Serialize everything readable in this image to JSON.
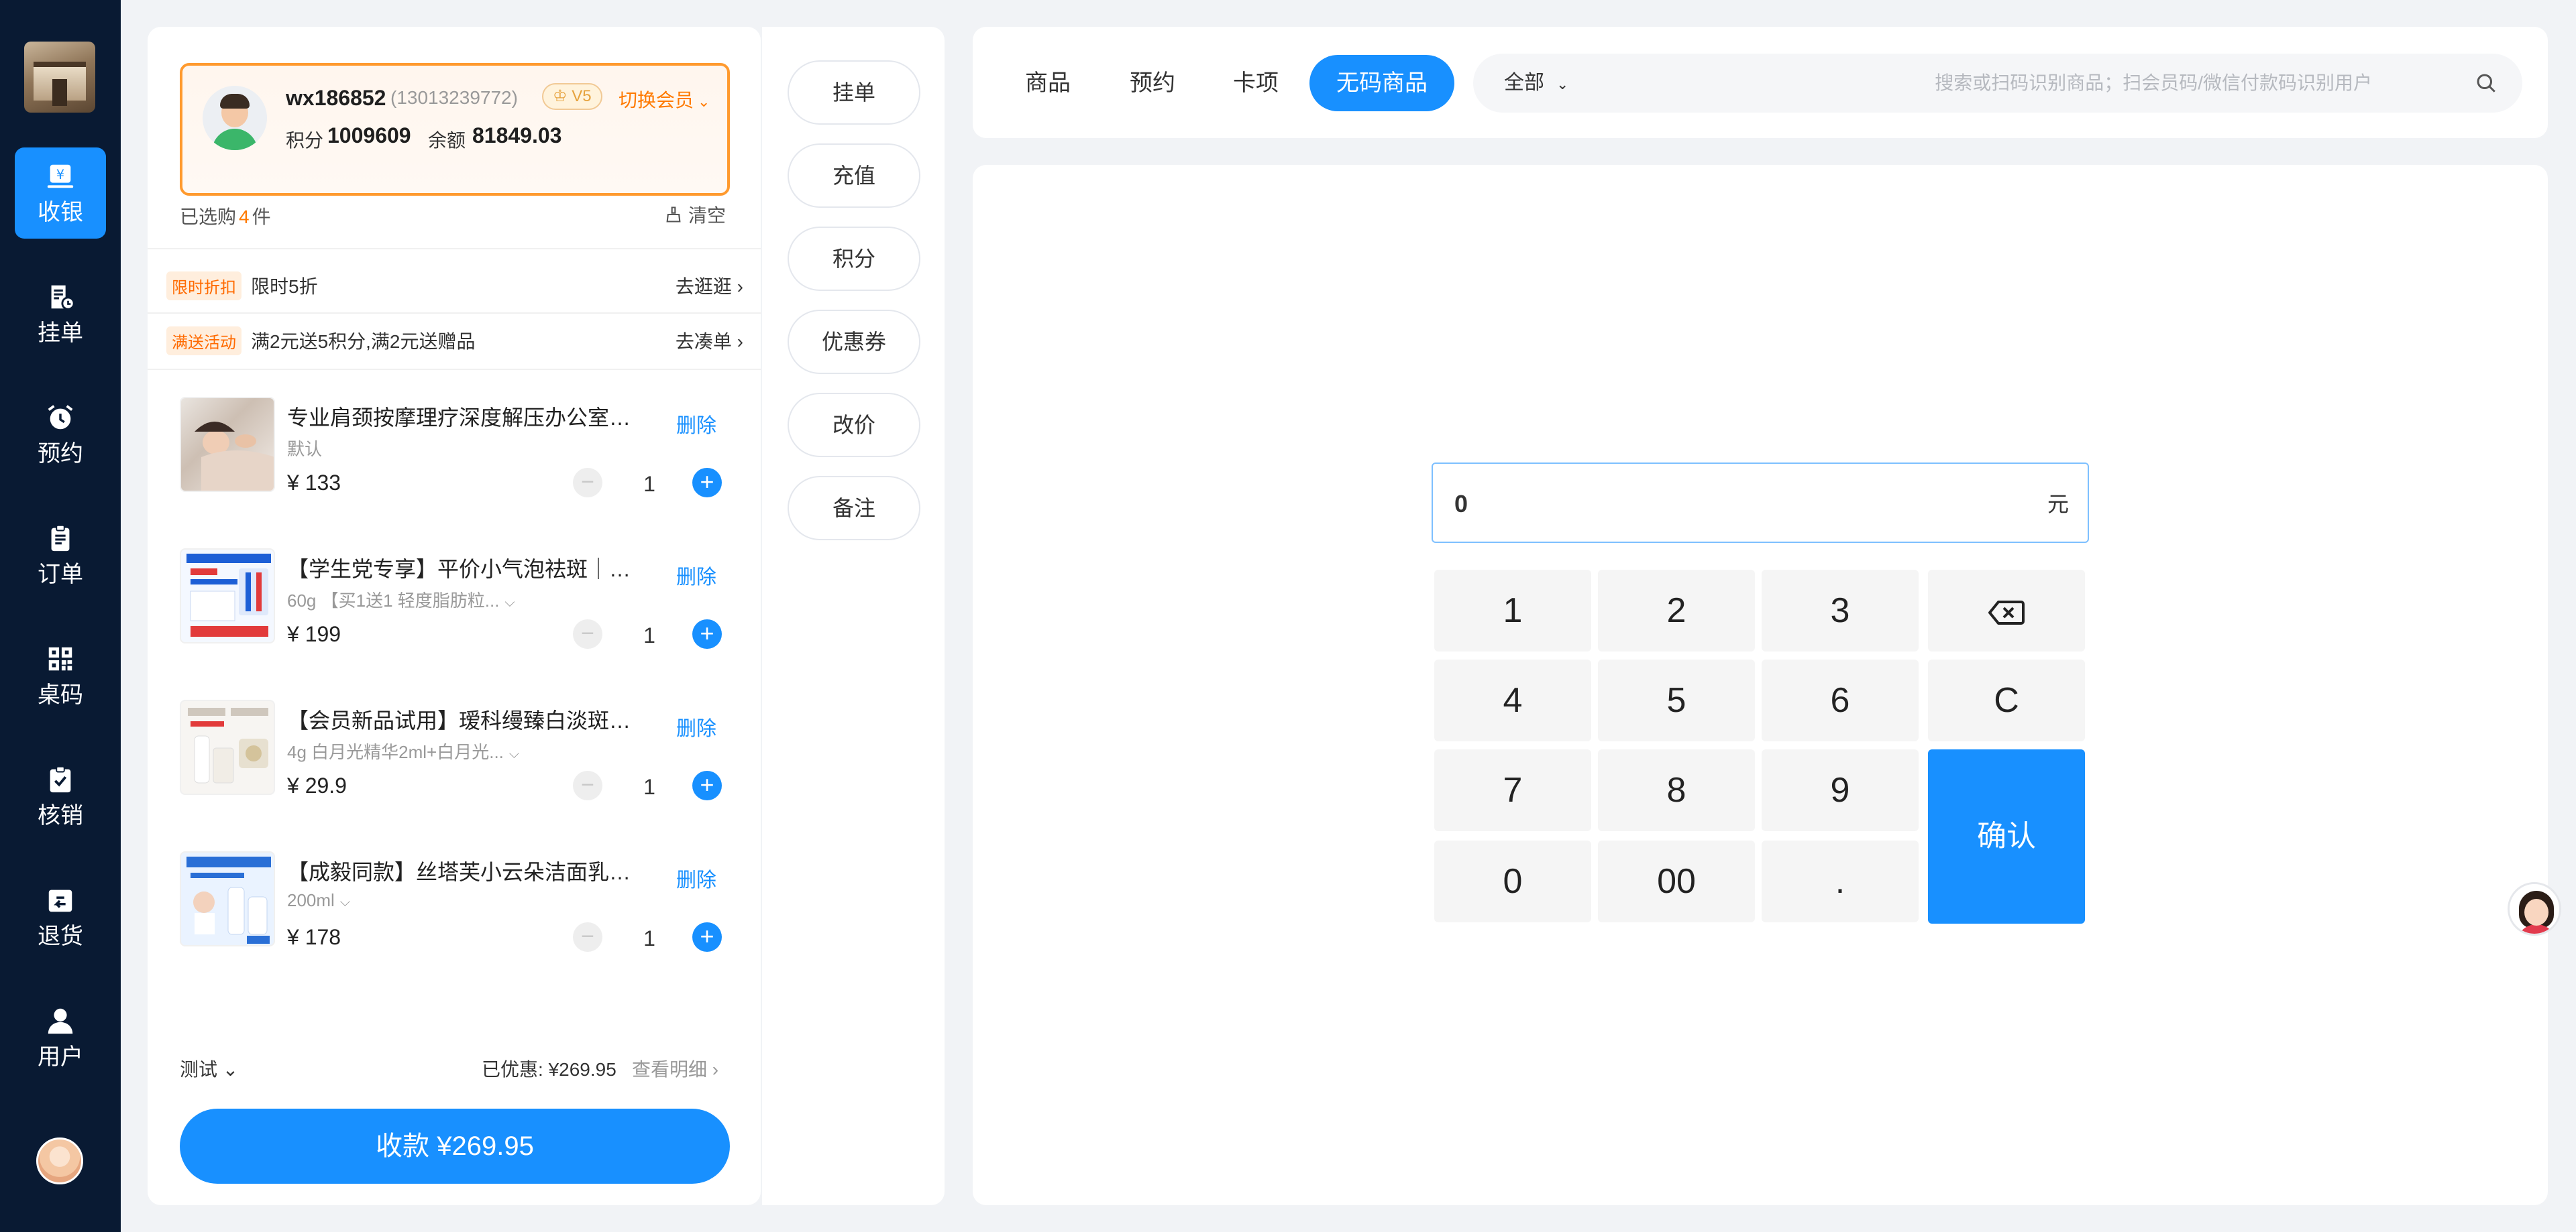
{
  "sidebar": {
    "items": [
      {
        "label": "收银",
        "icon": "cashier-icon",
        "active": true
      },
      {
        "label": "挂单",
        "icon": "hold-order-icon"
      },
      {
        "label": "预约",
        "icon": "alarm-clock-icon"
      },
      {
        "label": "订单",
        "icon": "clipboard-icon"
      },
      {
        "label": "桌码",
        "icon": "qr-code-icon"
      },
      {
        "label": "核销",
        "icon": "verify-check-icon"
      },
      {
        "label": "退货",
        "icon": "return-icon"
      },
      {
        "label": "用户",
        "icon": "user-icon"
      }
    ]
  },
  "member": {
    "name": "wx186852",
    "phone": "(13013239772)",
    "level": "V5",
    "switch_label": "切换会员",
    "points_label": "积分",
    "points": "1009609",
    "balance_label": "余额",
    "balance": "81849.03"
  },
  "cart": {
    "count_prefix": "已选购",
    "count": "4",
    "count_suffix": "件",
    "clear_label": "清空",
    "promos": [
      {
        "badge": "限时折扣",
        "text": "限时5折",
        "link": "去逛逛"
      },
      {
        "badge": "满送活动",
        "text": "满2元送5积分,满2元送赠品",
        "link": "去凑单"
      }
    ],
    "items": [
      {
        "title": "专业肩颈按摩理疗深度解压办公室人群",
        "spec": "默认",
        "has_spec_dropdown": false,
        "price": "¥ 133",
        "qty": "1",
        "delete_label": "删除"
      },
      {
        "title": "【学生党专享】平价小气泡祛斑｜精华乳液",
        "spec": "60g 【买1送1 轻度脂肪粒...",
        "has_spec_dropdown": true,
        "price": "¥ 199",
        "qty": "1",
        "delete_label": "删除"
      },
      {
        "title": "【会员新品试用】瑷科缦臻白淡斑精华套装",
        "spec": "4g 白月光精华2ml+白月光...",
        "has_spec_dropdown": true,
        "price": "¥ 29.9",
        "qty": "1",
        "delete_label": "删除"
      },
      {
        "title": "【成毅同款】丝塔芙小云朵洁面乳温和清洁",
        "spec": "200ml",
        "has_spec_dropdown": true,
        "price": "¥ 178",
        "qty": "1",
        "delete_label": "删除"
      }
    ],
    "operator": "测试",
    "discount_label": "已优惠: ",
    "discount_value": "¥269.95",
    "view_detail": "查看明细",
    "checkout_label": "收款 ¥269.95"
  },
  "actions": [
    "挂单",
    "充值",
    "积分",
    "优惠券",
    "改价",
    "备注"
  ],
  "tabs": [
    {
      "label": "商品",
      "active": false
    },
    {
      "label": "预约",
      "active": false
    },
    {
      "label": "卡项",
      "active": false
    },
    {
      "label": "无码商品",
      "active": true
    }
  ],
  "search": {
    "scope": "全部",
    "placeholder": "搜索或扫码识别商品；扫会员码/微信付款码识别用户"
  },
  "keypad": {
    "amount": "0",
    "unit": "元",
    "keys": [
      "1",
      "2",
      "3",
      "4",
      "5",
      "6",
      "7",
      "8",
      "9",
      "0",
      "00",
      "."
    ],
    "clear_key": "C",
    "backspace_icon": "backspace-icon",
    "confirm_label": "确认"
  },
  "colors": {
    "sidebar_bg": "#091a33",
    "primary": "#1890ff",
    "member_border": "#ff9a2e",
    "promo_badge": "#ff6a00"
  }
}
